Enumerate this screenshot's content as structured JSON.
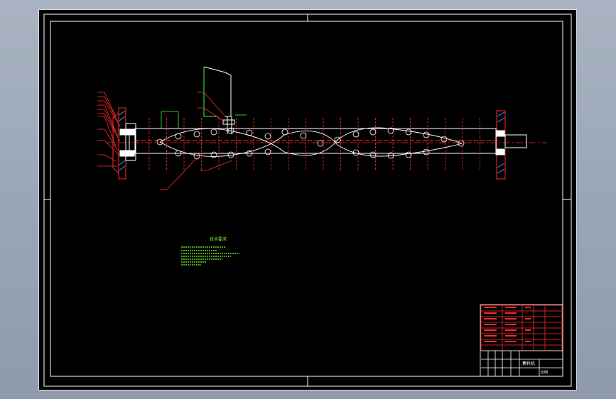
{
  "drawing": {
    "background": "#000000",
    "colors": {
      "outline": "#ffffff",
      "centerline": "#ff2a2a",
      "leader": "#ff2a2a",
      "dims": "#33ff33",
      "notes": "#7dff2a",
      "titleblock": "#ff2a2a"
    },
    "notes_heading": "技术要求",
    "title_block": {
      "drawing_name": "集料机",
      "scale_label": "比例"
    }
  }
}
